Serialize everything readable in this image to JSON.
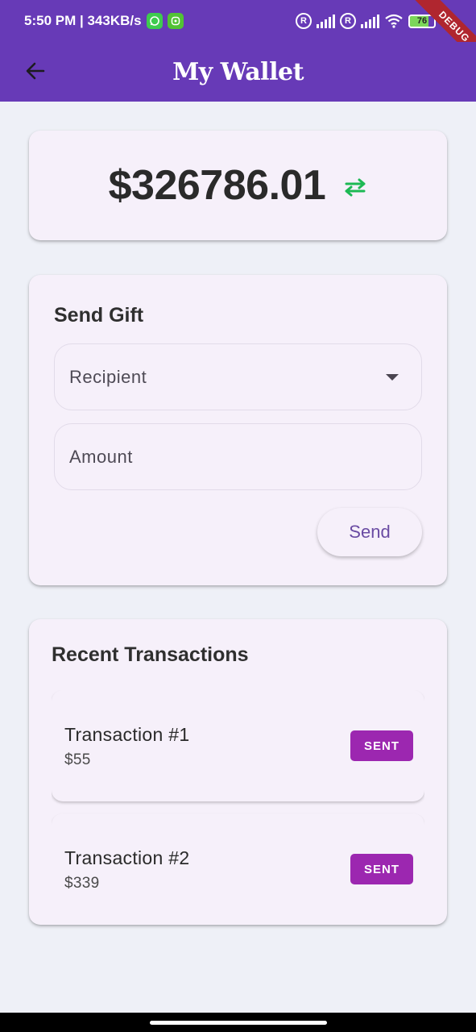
{
  "status_bar": {
    "time_speed": "5:50 PM | 343KB/s",
    "battery": "76",
    "ribbon": "DEBUG",
    "reg_mark": "R"
  },
  "app_bar": {
    "back_icon": "arrow-left-icon",
    "title": "My Wallet"
  },
  "balance": {
    "amount": "$326786.01",
    "swap_icon": "swap-arrows-icon",
    "swap_color": "#1db954"
  },
  "send_gift": {
    "heading": "Send Gift",
    "recipient_placeholder": "Recipient",
    "amount_placeholder": "Amount",
    "send_label": "Send"
  },
  "transactions": {
    "heading": "Recent Transactions",
    "items": [
      {
        "title": "Transaction #1",
        "amount": "$55",
        "status": "SENT"
      },
      {
        "title": "Transaction #2",
        "amount": "$339",
        "status": "SENT"
      }
    ]
  },
  "colors": {
    "primary": "#673ab7",
    "badge": "#9c27b0",
    "background": "#eef0f7",
    "card": "#f6f0fa"
  }
}
